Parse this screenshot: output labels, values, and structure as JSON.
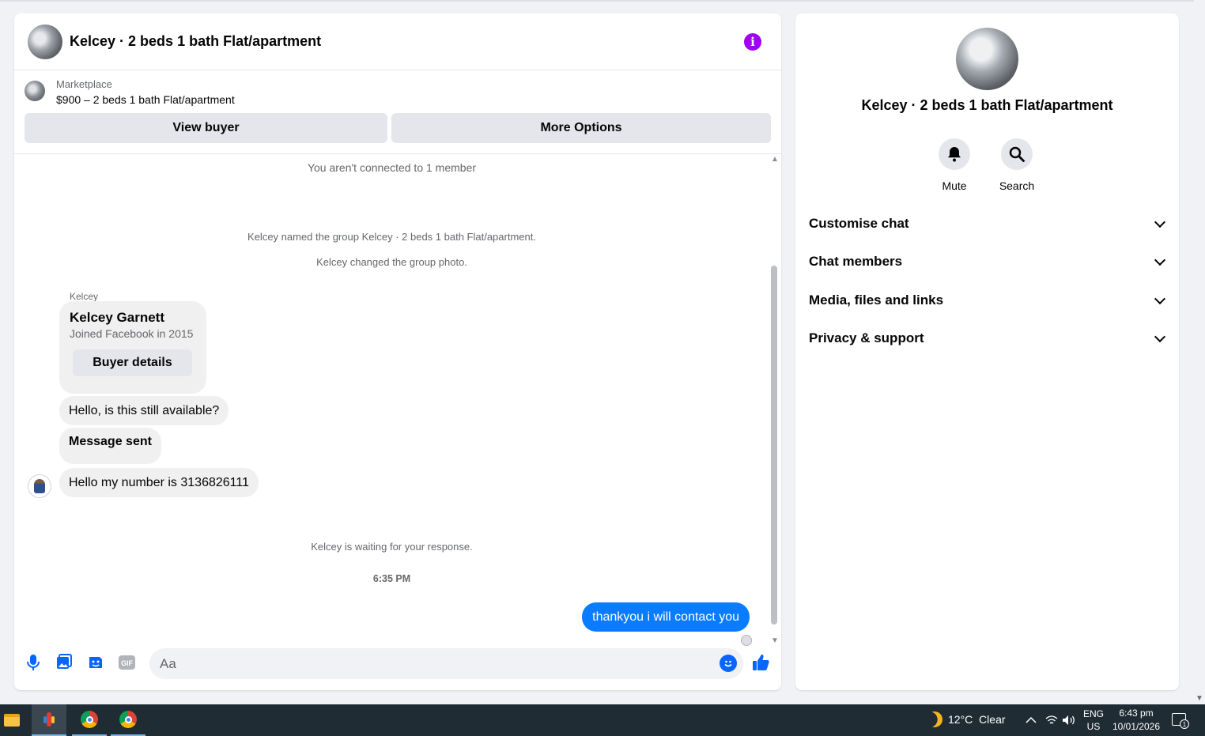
{
  "chat": {
    "title": "Kelcey · 2 beds 1 bath Flat/apartment",
    "marketplace_label": "Marketplace",
    "listing": "$900 – 2 beds 1 bath Flat/apartment",
    "view_buyer_label": "View buyer",
    "more_options_label": "More Options"
  },
  "messages": {
    "system_not_connected": "You aren't connected to 1 member",
    "system_named": "Kelcey named the group Kelcey · 2 beds 1 bath Flat/apartment.",
    "system_photo": "Kelcey changed the group photo.",
    "sender": "Kelcey",
    "card_name": "Kelcey Garnett",
    "card_sub": "Joined Facebook in 2015",
    "card_button": "Buyer details",
    "msg1": "Hello, is this still available?",
    "msg2": "Message sent",
    "msg3": "Hello my number is 3136826111",
    "waiting": "Kelcey is waiting for your response.",
    "timestamp": "6:35 PM",
    "outgoing": "thankyou i will contact you"
  },
  "composer": {
    "placeholder": "Aa",
    "gif_label": "GIF"
  },
  "info": {
    "title": "Kelcey · 2 beds 1 bath Flat/apartment",
    "mute_label": "Mute",
    "search_label": "Search",
    "sections": [
      "Customise chat",
      "Chat members",
      "Media, files and links",
      "Privacy & support"
    ]
  },
  "taskbar": {
    "weather": "12°C  Clear",
    "lang1": "ENG",
    "lang2": "US",
    "time": "6:43 pm",
    "date": "10/01/2026",
    "notif_count": "1"
  },
  "colors": {
    "accent": "#0866ff",
    "outgoing_bubble": "#0a7cff",
    "info_icon": "#a100f2",
    "taskbar": "#202c34"
  }
}
